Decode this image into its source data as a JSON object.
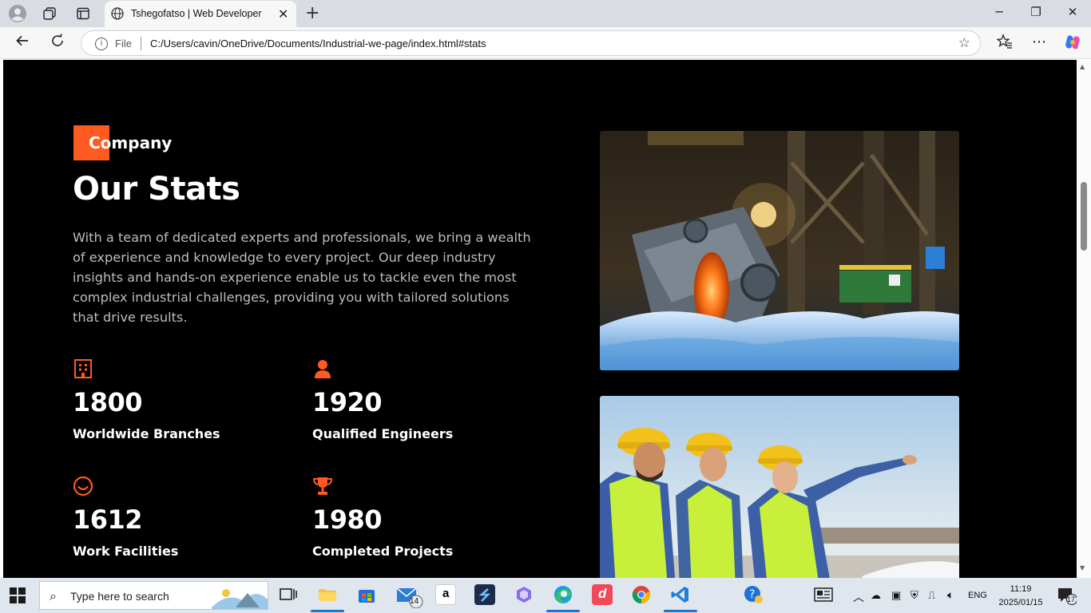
{
  "browser": {
    "tab_title": "Tshegofatso | Web Developer",
    "address_scheme": "File",
    "address_url": "C:/Users/cavin/OneDrive/Documents/Industrial-we-page/index.html#stats"
  },
  "page": {
    "section_tag": "Company",
    "heading": "Our Stats",
    "intro": "With a team of dedicated experts and professionals, we bring a wealth of experience and knowledge to every project. Our deep industry insights and hands-on experience enable us to tackle even the most complex industrial challenges, providing you with tailored solutions that drive results.",
    "accent_color": "#ff5a1f",
    "stats": [
      {
        "icon": "building-icon",
        "number": "1800",
        "label": "Worldwide Branches"
      },
      {
        "icon": "user-icon",
        "number": "1920",
        "label": "Qualified Engineers"
      },
      {
        "icon": "smile-icon",
        "number": "1612",
        "label": "Work Facilities"
      },
      {
        "icon": "trophy-icon",
        "number": "1980",
        "label": "Completed Projects"
      }
    ],
    "images": [
      {
        "name": "foundry-image",
        "depicts": "molten steel ladle in an industrial foundry"
      },
      {
        "name": "engineers-image",
        "depicts": "three engineers in hard hats pointing outdoors"
      }
    ]
  },
  "taskbar": {
    "search_placeholder": "Type here to search",
    "mail_badge": "14",
    "language": "ENG",
    "time": "11:19",
    "date": "2025/01/15",
    "notification_count": "17"
  }
}
